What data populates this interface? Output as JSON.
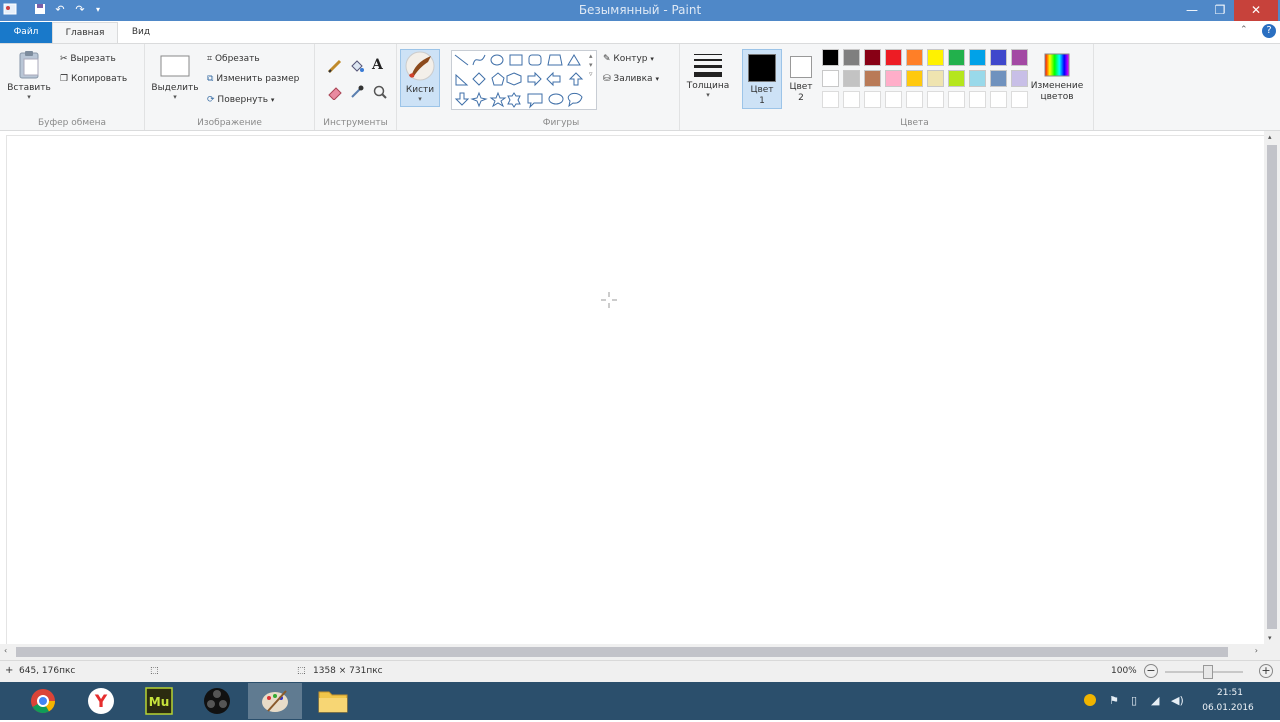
{
  "window": {
    "title": "Безымянный - Paint",
    "controls": [
      "—",
      "❐",
      "✕"
    ]
  },
  "tabs": {
    "file": "Файл",
    "home": "Главная",
    "view": "Вид"
  },
  "ribbon": {
    "clipboard": {
      "paste": "Вставить",
      "cut": "Вырезать",
      "copy": "Копировать",
      "label": "Буфер обмена"
    },
    "image": {
      "select": "Выделить",
      "crop": "Обрезать",
      "resize": "Изменить размер",
      "rotate": "Повернуть",
      "label": "Изображение"
    },
    "tools": {
      "label": "Инструменты"
    },
    "brushes": {
      "label": "Кисти"
    },
    "shapes": {
      "outline": "Контур",
      "fill": "Заливка",
      "label": "Фигуры"
    },
    "size": {
      "label": "Толщина"
    },
    "colors": {
      "color1_line1": "Цвет",
      "color1_line2": "1",
      "color2_line1": "Цвет",
      "color2_line2": "2",
      "edit_line1": "Изменение",
      "edit_line2": "цветов",
      "label": "Цвета",
      "color1": "#000000",
      "color2": "#ffffff",
      "palette_row1": [
        "#000000",
        "#7f7f7f",
        "#880015",
        "#ed1c24",
        "#ff7f27",
        "#fff200",
        "#22b14c",
        "#00a2e8",
        "#3f48cc",
        "#a349a4"
      ],
      "palette_row2": [
        "#ffffff",
        "#c3c3c3",
        "#b97a57",
        "#ffaec9",
        "#ffc90e",
        "#efe4b0",
        "#b5e61d",
        "#99d9ea",
        "#7092be",
        "#c8bfe7"
      ]
    }
  },
  "status": {
    "cursor_pos": "645, 176пкс",
    "canvas_size": "1358 × 731пкс",
    "zoom": "100%"
  },
  "taskbar": {
    "time": "21:51",
    "date": "06.01.2016"
  }
}
